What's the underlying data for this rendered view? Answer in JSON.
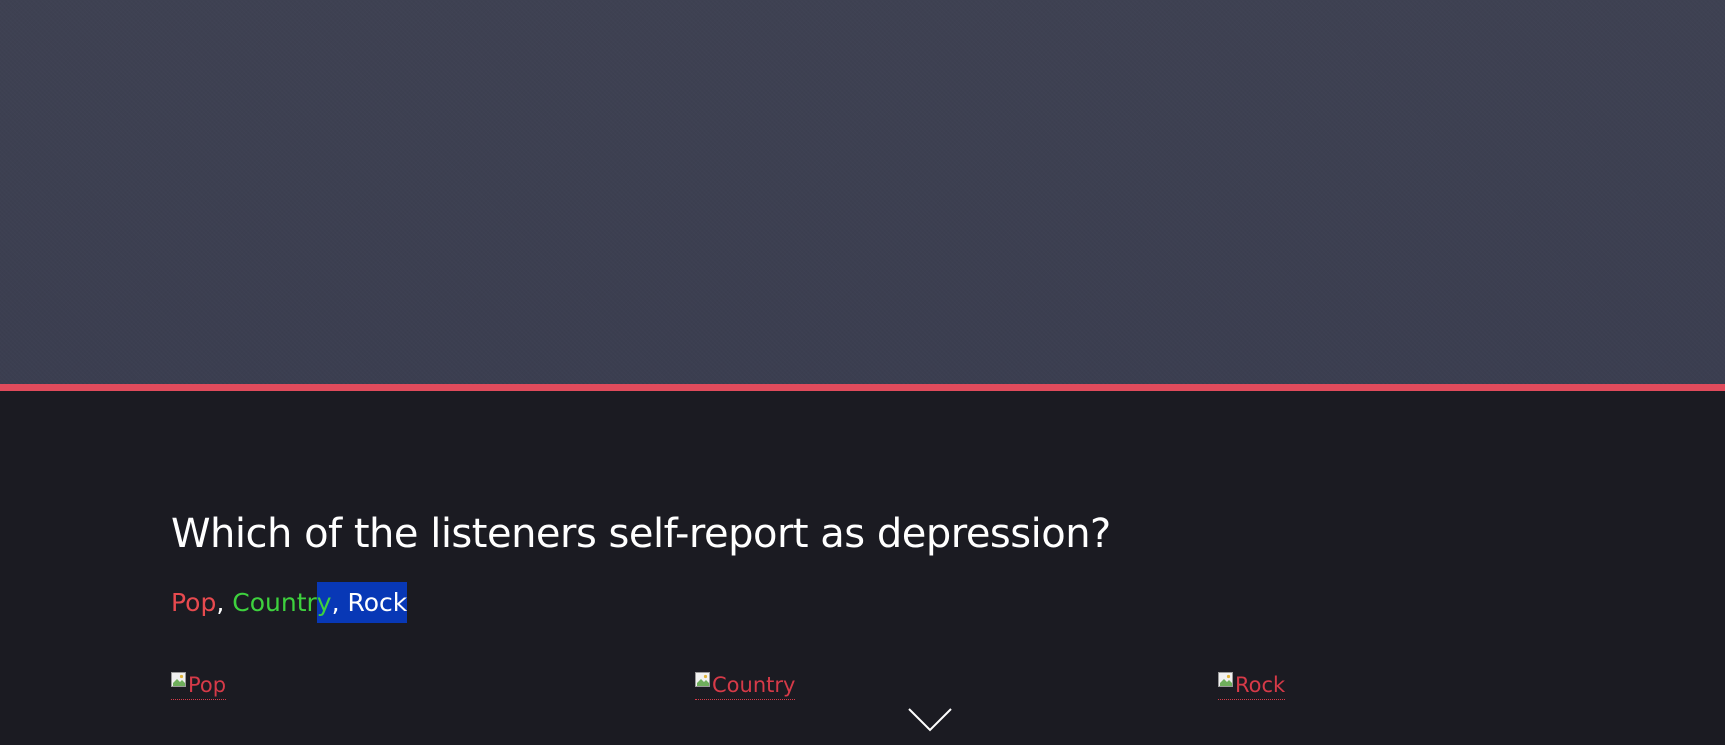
{
  "page": {
    "question": "Which of the listeners self-report as depression?",
    "answers": {
      "pop": "Pop",
      "sep1": ", ",
      "country_main": "Countr",
      "country_tail": "y",
      "sep2": ", ",
      "rock": "Rock"
    },
    "image_links": [
      {
        "alt": "Pop"
      },
      {
        "alt": "Country"
      },
      {
        "alt": "Rock"
      }
    ]
  },
  "colors": {
    "hero_bg": "#3c3f51",
    "accent_border": "#e04b5c",
    "content_bg": "#1b1b22",
    "pop": "#e84a4f",
    "country": "#3ed13e",
    "selection": "#0838b6",
    "link": "#d63a48"
  },
  "icons": {
    "broken_image": "broken-image-icon",
    "scroll_down": "chevron-down-icon"
  }
}
